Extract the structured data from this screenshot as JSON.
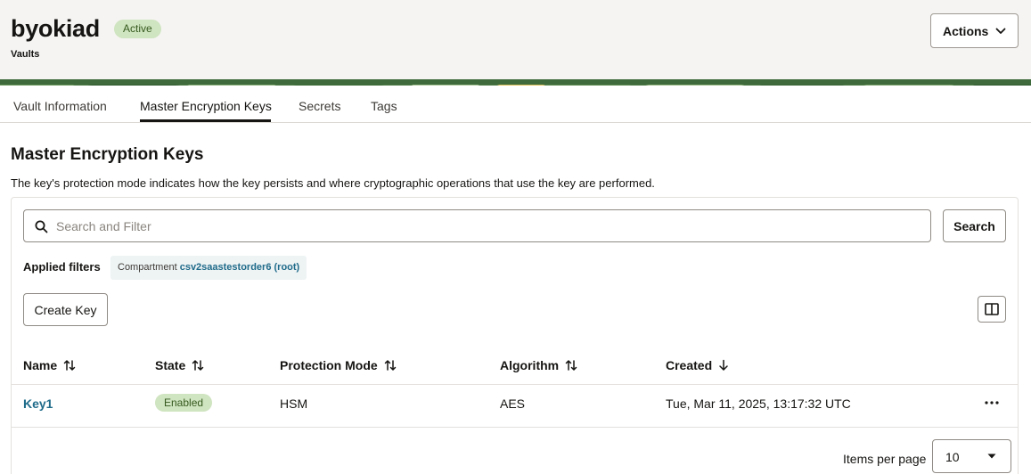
{
  "header": {
    "title": "byokiad",
    "status": "Active",
    "breadcrumb": "Vaults",
    "actions_label": "Actions"
  },
  "tabs": [
    {
      "label": "Vault Information"
    },
    {
      "label": "Master Encryption Keys",
      "active": true
    },
    {
      "label": "Secrets"
    },
    {
      "label": "Tags"
    }
  ],
  "section": {
    "title": "Master Encryption Keys",
    "description": "The key's protection mode indicates how the key persists and where cryptographic operations that use the key are performed."
  },
  "search": {
    "placeholder": "Search and Filter",
    "value": "",
    "button_label": "Search"
  },
  "filters": {
    "label": "Applied filters",
    "chip_name": "Compartment",
    "chip_value": "csv2saastestorder6 (root)"
  },
  "toolbar": {
    "create_label": "Create Key"
  },
  "table": {
    "columns": [
      "Name",
      "State",
      "Protection Mode",
      "Algorithm",
      "Created"
    ],
    "rows": [
      {
        "name": "Key1",
        "state": "Enabled",
        "protection_mode": "HSM",
        "algorithm": "AES",
        "created": "Tue, Mar 11, 2025, 13:17:32 UTC"
      }
    ]
  },
  "pagination": {
    "items_per_page_label": "Items per page",
    "items_per_page_value": "10"
  },
  "icons": {
    "actions": "chevron-down-icon",
    "search": "search-icon",
    "columns": "columns-icon",
    "sort": "sort-icon",
    "sort_desc": "arrow-down-icon",
    "more": "more-options-icon",
    "select": "caret-down-icon"
  },
  "colors": {
    "link": "#1f6b8a",
    "badge_bg": "#cfe4c0",
    "header_bg": "#f5f4f2"
  }
}
